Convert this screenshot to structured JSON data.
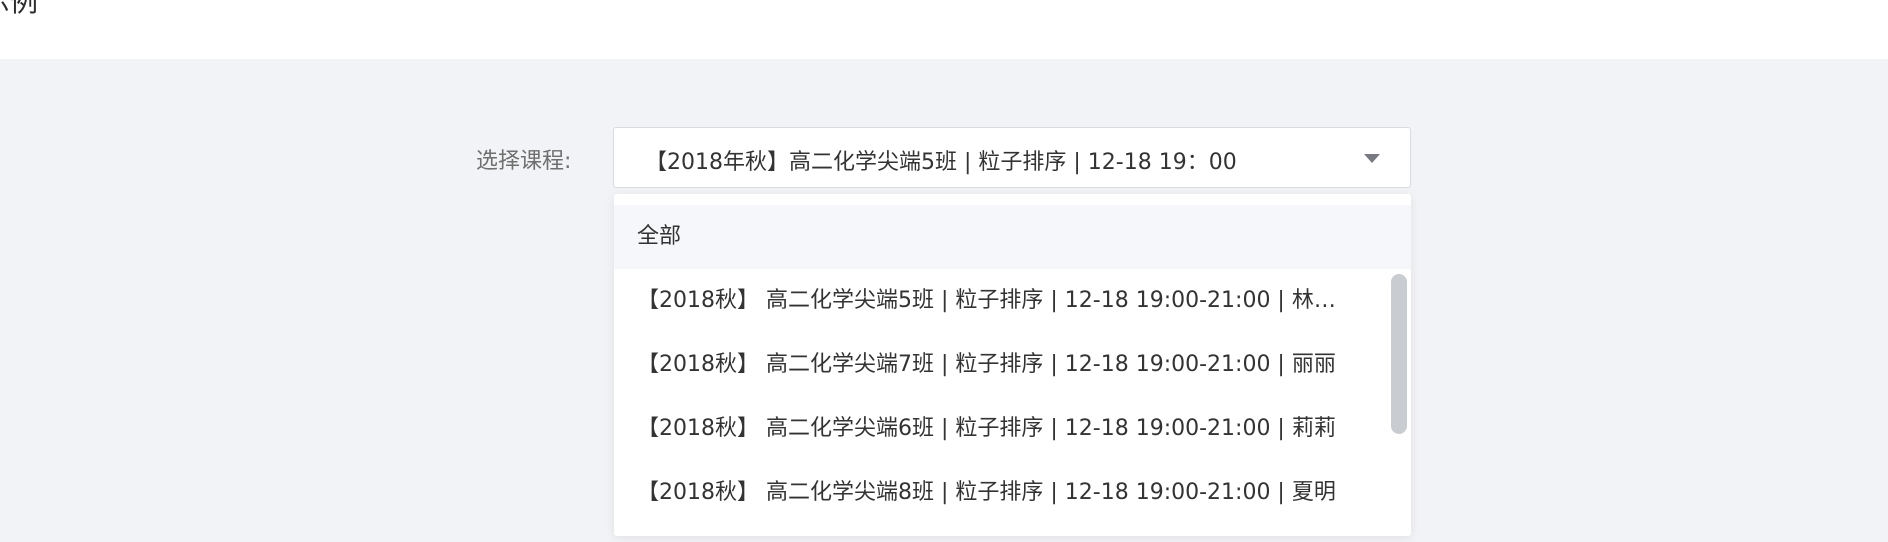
{
  "header": {
    "title": "示例"
  },
  "form": {
    "course_label": "选择课程:",
    "selected_course": "【2018年秋】高二化学尖端5班 | 粒子排序 | 12-18 19：00"
  },
  "dropdown": {
    "options": [
      {
        "label": "全部",
        "highlighted": true
      },
      {
        "label": "【2018秋】 高二化学尖端5班 | 粒子排序 | 12-18 19:00-21:00 |  林…",
        "highlighted": false
      },
      {
        "label": "【2018秋】 高二化学尖端7班 | 粒子排序 | 12-18 19:00-21:00 |  丽丽",
        "highlighted": false
      },
      {
        "label": "【2018秋】 高二化学尖端6班 | 粒子排序 | 12-18 19:00-21:00 |  莉莉",
        "highlighted": false
      },
      {
        "label": "【2018秋】 高二化学尖端8班 | 粒子排序 | 12-18 19:00-21:00 |  夏明",
        "highlighted": false
      }
    ]
  },
  "colors": {
    "page_background": "#f2f3f6",
    "header_background": "#ffffff",
    "option_highlight": "#f5f7fa",
    "text_primary": "#333333",
    "text_label": "#6f6f6f"
  },
  "icons": {
    "select_caret": "caret-down-icon"
  }
}
